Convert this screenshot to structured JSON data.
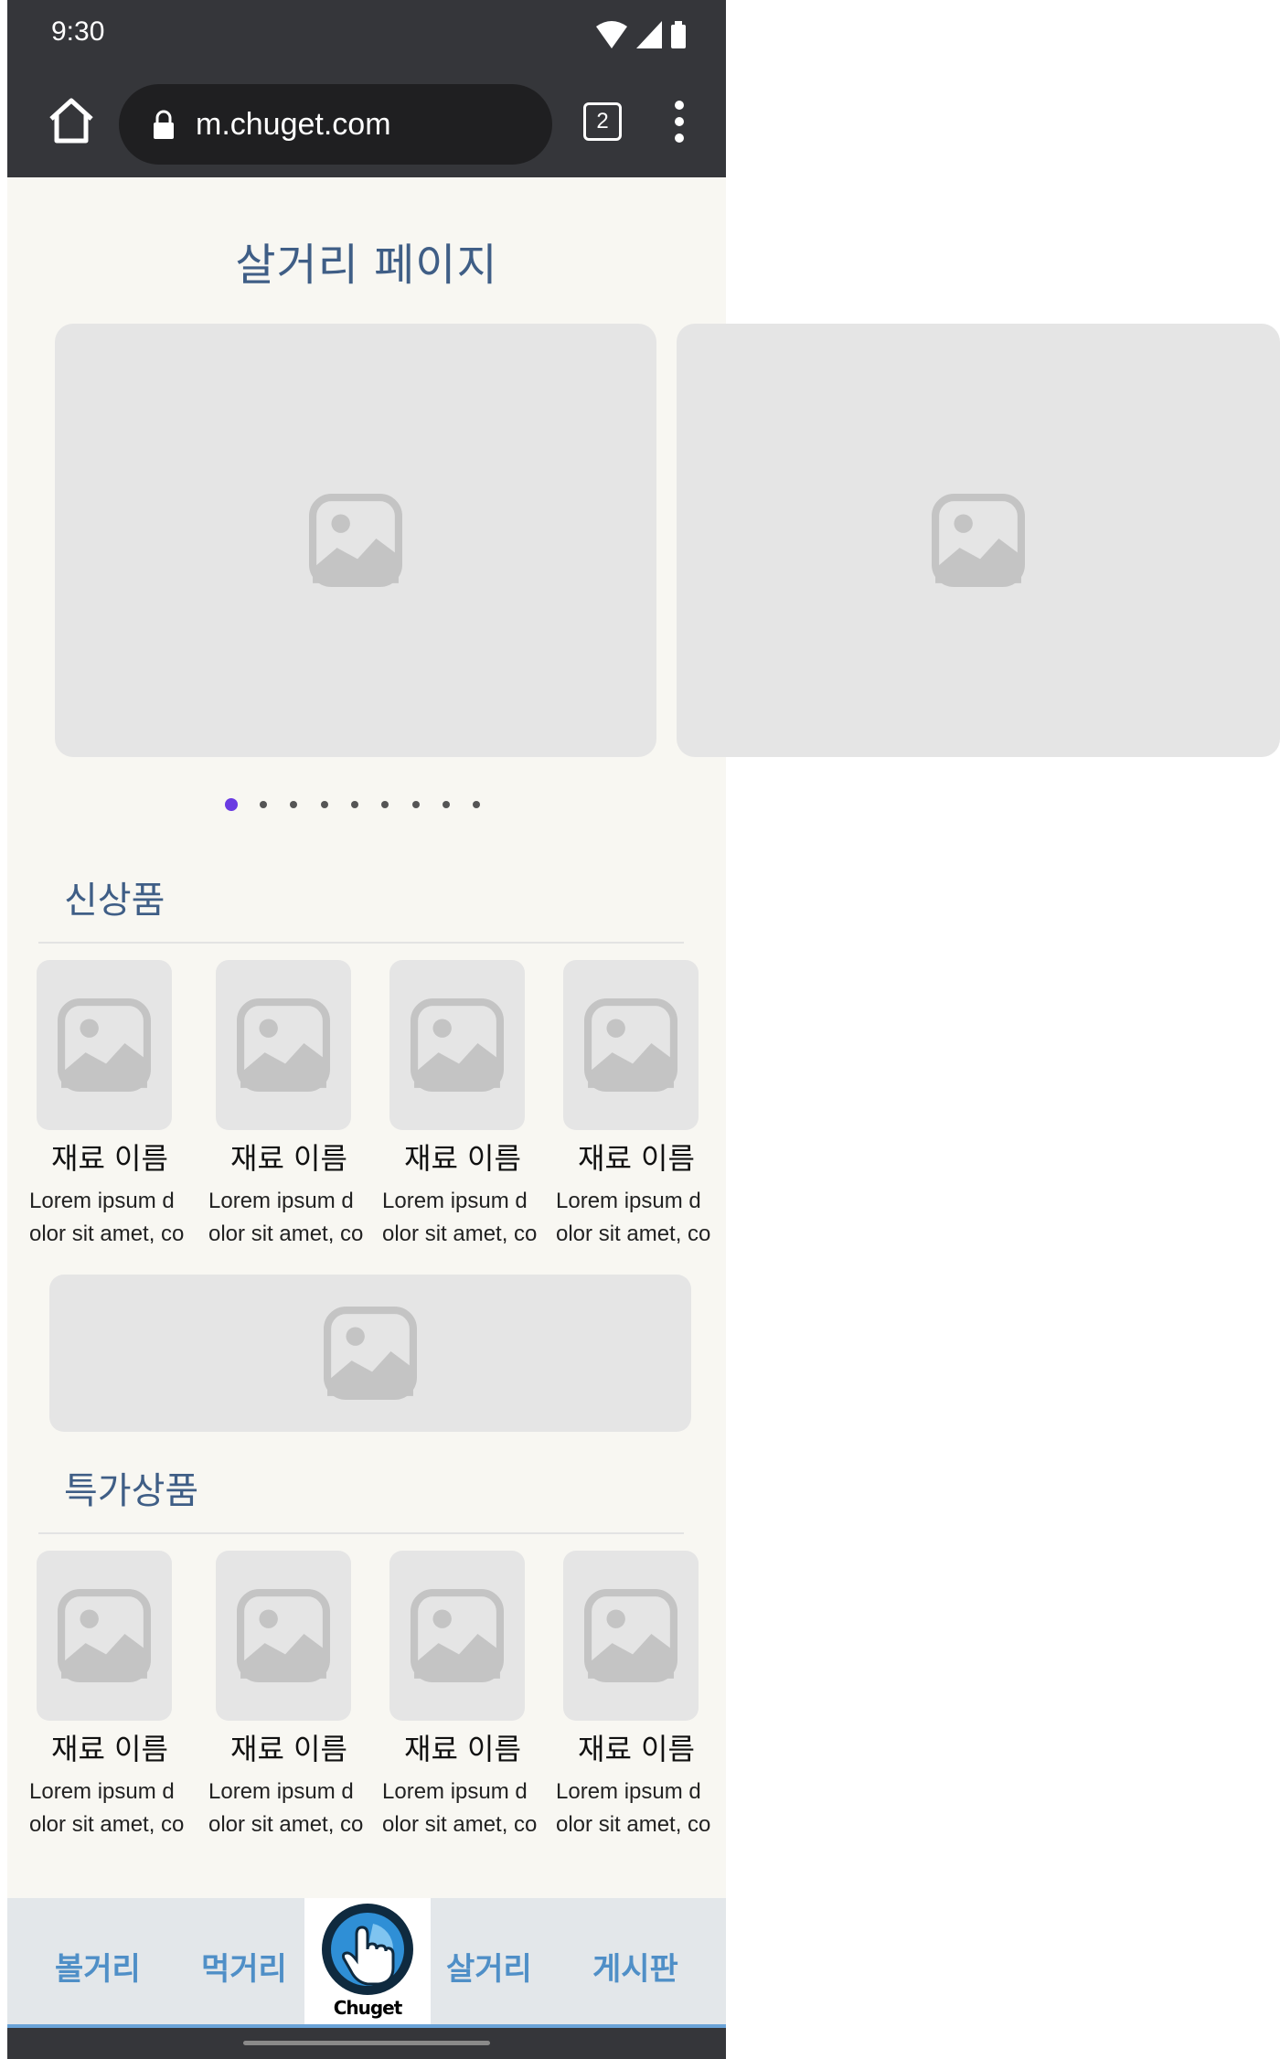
{
  "status_bar": {
    "time": "9:30"
  },
  "browser": {
    "url": "m.chuget.com",
    "tab_count": "2"
  },
  "page": {
    "title": "살거리 페이지"
  },
  "carousel": {
    "slide_count": 9,
    "active_index": 0,
    "accent_color": "#6a3be2"
  },
  "new_products": {
    "title": "신상품",
    "items": [
      {
        "name": "재료 이름",
        "desc_line1": "Lorem ipsum d",
        "desc_line2": "olor sit amet, co"
      },
      {
        "name": "재료 이름",
        "desc_line1": "Lorem ipsum d",
        "desc_line2": "olor sit amet, co"
      },
      {
        "name": "재료 이름",
        "desc_line1": "Lorem ipsum d",
        "desc_line2": "olor sit amet, co"
      },
      {
        "name": "재료 이름",
        "desc_line1": "Lorem ipsum d",
        "desc_line2": "olor sit amet, co"
      }
    ]
  },
  "special_products": {
    "title": "특가상품",
    "items": [
      {
        "name": "재료 이름",
        "desc_line1": "Lorem ipsum d",
        "desc_line2": "olor sit amet, co"
      },
      {
        "name": "재료 이름",
        "desc_line1": "Lorem ipsum d",
        "desc_line2": "olor sit amet, co"
      },
      {
        "name": "재료 이름",
        "desc_line1": "Lorem ipsum d",
        "desc_line2": "olor sit amet, co"
      },
      {
        "name": "재료 이름",
        "desc_line1": "Lorem ipsum d",
        "desc_line2": "olor sit amet, co"
      }
    ]
  },
  "bottom_nav": {
    "items": [
      "볼거리",
      "먹거리",
      "살거리",
      "게시판"
    ],
    "logo_text": "Chuget",
    "accent_color": "#4f8fc7"
  }
}
